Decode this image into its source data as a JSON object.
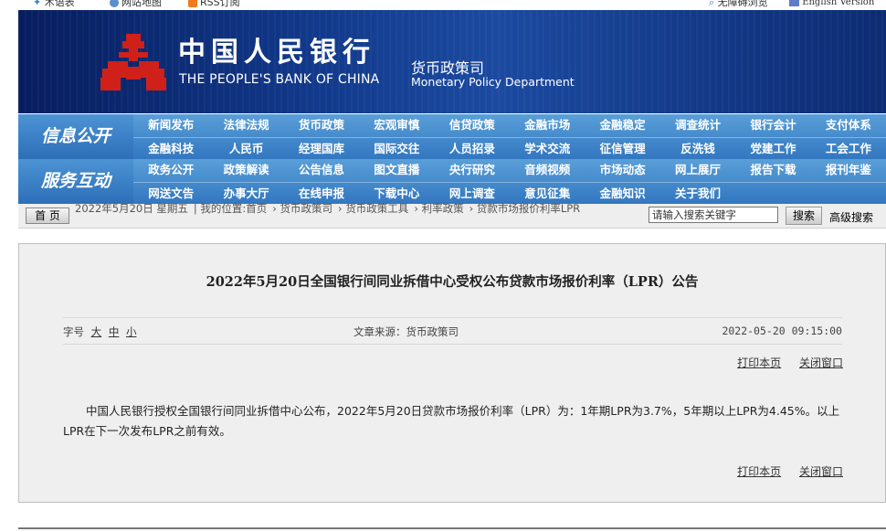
{
  "utility_bar": {
    "items": [
      "术语表",
      "网站地图",
      "RSS订阅"
    ],
    "right_items": [
      "无障碍浏览",
      "English Version"
    ]
  },
  "banner": {
    "bank_name_cn": "中国人民银行",
    "bank_name_en": "THE PEOPLE'S BANK OF CHINA",
    "department_cn": "货币政策司",
    "department_en": "Monetary Policy Department"
  },
  "nav": {
    "info_label": "信息公开",
    "info_row1": [
      "新闻发布",
      "法律法规",
      "货币政策",
      "宏观审慎",
      "信贷政策",
      "金融市场",
      "金融稳定",
      "调查统计",
      "银行会计",
      "支付体系"
    ],
    "info_row2": [
      "金融科技",
      "人民币",
      "经理国库",
      "国际交往",
      "人员招录",
      "学术交流",
      "征信管理",
      "反洗钱",
      "党建工作",
      "工会工作"
    ],
    "service_label": "服务互动",
    "service_row1": [
      "政务公开",
      "政策解读",
      "公告信息",
      "图文直播",
      "央行研究",
      "音频视频",
      "市场动态",
      "网上展厅",
      "报告下载",
      "报刊年鉴"
    ],
    "service_row2": [
      "网送文告",
      "办事大厅",
      "在线申报",
      "下载中心",
      "网上调查",
      "意见征集",
      "金融知识",
      "关于我们",
      "",
      ""
    ]
  },
  "breadcrumb": {
    "home_label": "首 页",
    "date": "2022年5月20日 星期五",
    "location_prefix": "我的位置:首页",
    "path": [
      "货币政策司",
      "货币政策工具",
      "利率政策",
      "贷款市场报价利率LPR"
    ],
    "search_placeholder": "请输入搜索关键字",
    "search_button": "搜索",
    "advanced_search": "高级搜索"
  },
  "article": {
    "title": "2022年5月20日全国银行间同业拆借中心受权公布贷款市场报价利率（LPR）公告",
    "font_size_label": "字号",
    "font_sizes": [
      "大",
      "中",
      "小"
    ],
    "source": "文章来源：货币政策司",
    "datetime": "2022-05-20 09:15:00",
    "print_label": "打印本页",
    "close_label": "关闭窗口",
    "body": "中国人民银行授权全国银行间同业拆借中心公布，2022年5月20日贷款市场报价利率（LPR）为：1年期LPR为3.7%，5年期以上LPR为4.45%。以上LPR在下一次发布LPR之前有效。"
  },
  "colors": {
    "banner": "#123a8c",
    "nav": "#3277c0",
    "logo_red": "#d0201a",
    "panel_bg": "#efefef"
  }
}
